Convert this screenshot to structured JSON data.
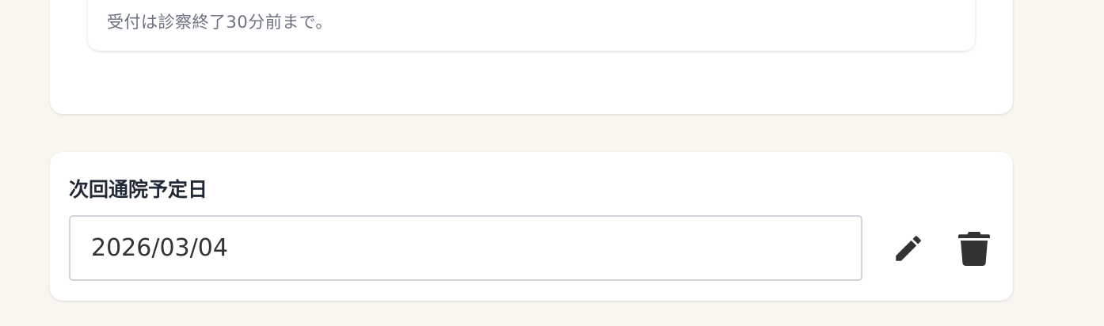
{
  "reception_card": {
    "note": "受付は診察終了30分前まで。"
  },
  "next_visit": {
    "title": "次回通院予定日",
    "date_value": "2026/03/04"
  },
  "actions": {
    "edit_icon": "pencil-icon",
    "delete_icon": "trash-icon"
  },
  "colors": {
    "page_background": "#f9f6f0",
    "card_background": "#ffffff",
    "icon_color": "#333333"
  }
}
